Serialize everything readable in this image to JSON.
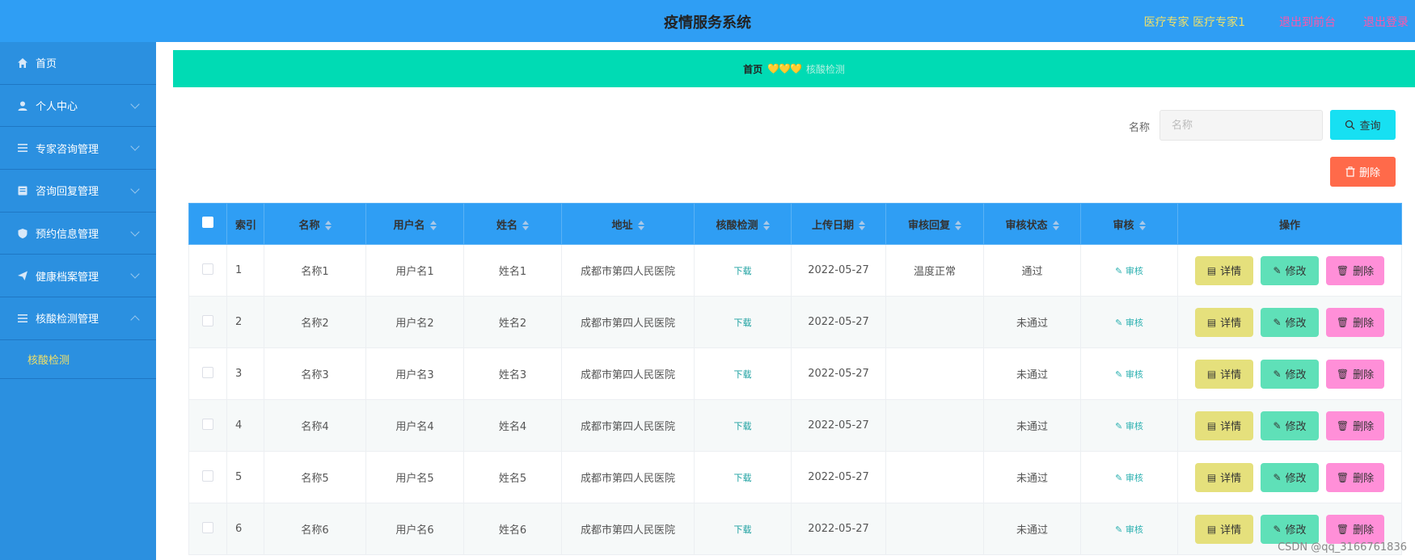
{
  "header": {
    "title": "疫情服务系统",
    "user": "医疗专家 医疗专家1",
    "exit_admin": "退出到前台",
    "logout": "退出登录"
  },
  "sidebar": {
    "items": [
      {
        "label": "首页",
        "icon": "home-icon"
      },
      {
        "label": "个人中心",
        "icon": "user-icon"
      },
      {
        "label": "专家咨询管理",
        "icon": "list-icon"
      },
      {
        "label": "咨询回复管理",
        "icon": "doc-icon"
      },
      {
        "label": "预约信息管理",
        "icon": "shield-icon"
      },
      {
        "label": "健康档案管理",
        "icon": "plane-icon"
      },
      {
        "label": "核酸检测管理",
        "icon": "list-icon"
      }
    ],
    "sub_item": "核酸检测"
  },
  "breadcrumb": {
    "home": "首页",
    "separator": "💛💛💛",
    "current": "核酸检测"
  },
  "search": {
    "label": "名称",
    "placeholder": "名称",
    "button": "查询"
  },
  "delete_button": "删除",
  "table": {
    "columns": [
      "索引",
      "名称",
      "用户名",
      "姓名",
      "地址",
      "核酸检测",
      "上传日期",
      "审核回复",
      "审核状态",
      "审核",
      "操作"
    ],
    "rows": [
      {
        "index": "1",
        "name": "名称1",
        "username": "用户名1",
        "realname": "姓名1",
        "address": "成都市第四人民医院",
        "report": "下载",
        "date": "2022-05-27",
        "reply": "温度正常",
        "status": "通过",
        "audit": "审核"
      },
      {
        "index": "2",
        "name": "名称2",
        "username": "用户名2",
        "realname": "姓名2",
        "address": "成都市第四人民医院",
        "report": "下载",
        "date": "2022-05-27",
        "reply": "",
        "status": "未通过",
        "audit": "审核"
      },
      {
        "index": "3",
        "name": "名称3",
        "username": "用户名3",
        "realname": "姓名3",
        "address": "成都市第四人民医院",
        "report": "下载",
        "date": "2022-05-27",
        "reply": "",
        "status": "未通过",
        "audit": "审核"
      },
      {
        "index": "4",
        "name": "名称4",
        "username": "用户名4",
        "realname": "姓名4",
        "address": "成都市第四人民医院",
        "report": "下载",
        "date": "2022-05-27",
        "reply": "",
        "status": "未通过",
        "audit": "审核"
      },
      {
        "index": "5",
        "name": "名称5",
        "username": "用户名5",
        "realname": "姓名5",
        "address": "成都市第四人民医院",
        "report": "下载",
        "date": "2022-05-27",
        "reply": "",
        "status": "未通过",
        "audit": "审核"
      },
      {
        "index": "6",
        "name": "名称6",
        "username": "用户名6",
        "realname": "姓名6",
        "address": "成都市第四人民医院",
        "report": "下载",
        "date": "2022-05-27",
        "reply": "",
        "status": "未通过",
        "audit": "审核"
      }
    ],
    "actions": {
      "detail": "详情",
      "edit": "修改",
      "delete": "删除"
    }
  },
  "watermark": "CSDN @qq_3166761836",
  "colors": {
    "header": "#2f9ef4",
    "sidebar": "#2b90e0",
    "breadcrumb": "#00dbb4",
    "search_button": "#17e0f2",
    "delete_button": "#ff6a4a",
    "detail": "#e5e07c",
    "edit": "#5fe0b8",
    "remove": "#ff8fd8"
  }
}
